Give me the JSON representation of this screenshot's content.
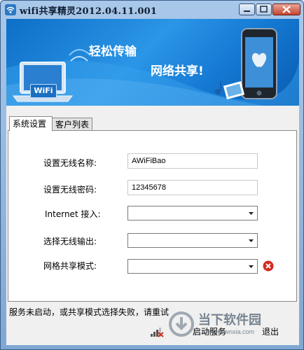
{
  "window": {
    "title": "wifi共享精灵2012.04.11.001"
  },
  "banner": {
    "line1": "轻松传输",
    "line2": "网络共享!",
    "wifi_label": "WiFi"
  },
  "tabs": [
    {
      "label": "系统设置"
    },
    {
      "label": "客户列表"
    }
  ],
  "form": {
    "ssid_label": "设置无线名称:",
    "ssid_value": "AWiFiBao",
    "password_label": "设置无线密码:",
    "password_value": "12345678",
    "internet_label": "Internet 接入:",
    "internet_value": "",
    "output_label": "选择无线输出:",
    "output_value": "",
    "share_mode_label": "网格共享模式:",
    "share_mode_value": ""
  },
  "status": {
    "text": "服务未启动，或共享模式选择失败，请重试"
  },
  "buttons": {
    "start": "启动服务",
    "exit": "退出"
  },
  "watermark": {
    "main": "当下软件园",
    "sub": "www.downxia.com"
  },
  "colors": {
    "banner_blue": "#1479d3",
    "error_red": "#d32b1f",
    "frame_blue": "#7fa7d3"
  }
}
